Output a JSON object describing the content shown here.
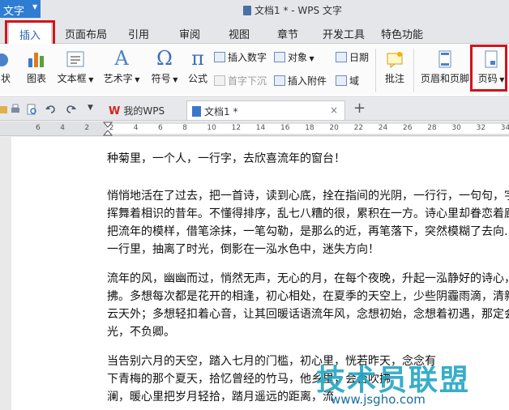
{
  "window": {
    "app_button": "文字",
    "title": "文档1 * - WPS 文字"
  },
  "tabs": [
    {
      "label": "插入"
    },
    {
      "label": "页面布局"
    },
    {
      "label": "引用"
    },
    {
      "label": "审阅"
    },
    {
      "label": "视图"
    },
    {
      "label": "章节"
    },
    {
      "label": "开发工具"
    },
    {
      "label": "特色功能"
    }
  ],
  "ribbon": {
    "shape": "状",
    "chart": "图表",
    "textbox": "文本框",
    "wordart": "艺术字",
    "symbol": "符号",
    "formula": "公式",
    "insert_number": "插入数字",
    "object": "对象",
    "date": "日期",
    "dropcap": "首字下沉",
    "attachment": "插入附件",
    "field": "域",
    "comment": "批注",
    "header_footer": "页眉和页脚",
    "page_number": "页码"
  },
  "doc_tabs": [
    {
      "label": "我的WPS"
    },
    {
      "label": "文档1 *"
    }
  ],
  "ruler_numbers": [
    "6",
    "4",
    "2",
    "2",
    "4",
    "6",
    "8",
    "10",
    "12",
    "14",
    "16",
    "18",
    "20",
    "22",
    "24",
    "26",
    "28",
    "30",
    "32",
    "34"
  ],
  "document": {
    "lines": [
      "种菊里，一个人，一行字，去欣喜流年的窗台！",
      "悄悄地活在了过去，把一首诗，读到心底，拴在指间的光阴，一行行，一句句，字",
      "挥舞着相识的昔年。不懂得排序，乱七八糟的很，累积在一方。诗心里却眷恋着廊桥",
      "把流年的模样，借笔涂抹，一笔勾勒，是那么的近，再笔落下，突然模糊了去向…",
      "一行里，抽离了时光，倒影在一泓水色中，迷失方向！",
      "流年的风，幽幽而过，悄然无声，无心的月，在每个夜晚，升起一泓静好的诗心，",
      "拂。多想每次都是花开的相逢，初心相处，在夏季的天空上，少些阴霾雨滴，清新",
      "云天外；多想轻扣着心音，让其回暖话语流年风，念想初始，念想着初遇，那定会",
      "光，不负卿。",
      "当告别六月的天空，踏入七月的门槛，初心里，恍若昨天，念念有",
      "下青梅的那个夏天，拾忆曾经的竹马，他乡里，会否吹拂",
      "澜，暖心里把岁月轻拾，踏月遥远的距离，流"
    ],
    "watermark": "技术员联盟",
    "watermark_url": "www.jsgho.com"
  },
  "colors": {
    "accent": "#2f7dd2",
    "highlight": "#d0141b"
  }
}
